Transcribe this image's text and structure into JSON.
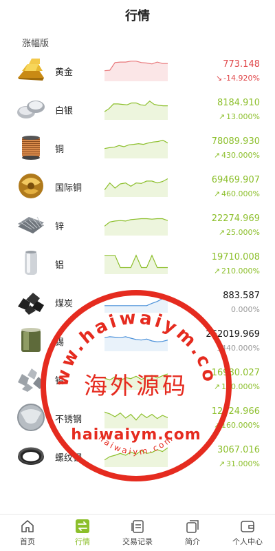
{
  "header": {
    "title": "行情"
  },
  "section": {
    "title": "涨幅版"
  },
  "colors": {
    "up": "#8cbf2b",
    "down": "#e0474a",
    "flat": "#111111",
    "accent": "#8cbf2b"
  },
  "items": [
    {
      "name": "黄金",
      "price": "773.148",
      "change": "-14.920%",
      "trend": "down",
      "icon": "gold-bars-icon",
      "spark": [
        0.45,
        0.47,
        0.8,
        0.82,
        0.82,
        0.86,
        0.86,
        0.8,
        0.78,
        0.74,
        0.82,
        0.76,
        0.76
      ]
    },
    {
      "name": "白银",
      "price": "8184.910",
      "change": "13.000%",
      "trend": "up",
      "icon": "silver-ingots-icon",
      "spark": [
        0.35,
        0.48,
        0.68,
        0.68,
        0.66,
        0.64,
        0.72,
        0.72,
        0.64,
        0.62,
        0.8,
        0.66,
        0.62,
        0.6,
        0.6
      ]
    },
    {
      "name": "铜",
      "price": "78089.930",
      "change": "430.000%",
      "trend": "up",
      "icon": "copper-coil-icon",
      "spark": [
        0.42,
        0.46,
        0.48,
        0.55,
        0.5,
        0.58,
        0.6,
        0.63,
        0.6,
        0.66,
        0.7,
        0.72,
        0.78,
        0.66
      ]
    },
    {
      "name": "国际铜",
      "price": "69469.907",
      "change": "460.000%",
      "trend": "up",
      "icon": "copper-ball-icon",
      "spark": [
        0.3,
        0.6,
        0.38,
        0.56,
        0.6,
        0.46,
        0.6,
        0.58,
        0.68,
        0.68,
        0.6,
        0.66,
        0.78
      ]
    },
    {
      "name": "锌",
      "price": "22274.969",
      "change": "25.000%",
      "trend": "up",
      "icon": "zinc-sheets-icon",
      "spark": [
        0.4,
        0.58,
        0.62,
        0.64,
        0.62,
        0.68,
        0.7,
        0.72,
        0.72,
        0.7,
        0.72,
        0.72,
        0.64
      ]
    },
    {
      "name": "铝",
      "price": "19710.008",
      "change": "210.000%",
      "trend": "up",
      "icon": "aluminum-can-icon",
      "spark": [
        0.8,
        0.8,
        0.8,
        0.28,
        0.28,
        0.28,
        0.8,
        0.28,
        0.28,
        0.8,
        0.28,
        0.28,
        0.28
      ]
    },
    {
      "name": "煤炭",
      "price": "883.587",
      "change": "0.000%",
      "trend": "flat",
      "icon": "coal-icon",
      "spark": [
        0.3,
        0.3,
        0.3,
        0.3,
        0.3,
        0.3,
        0.3,
        0.3,
        0.3,
        0.4,
        0.48,
        0.6,
        0.68
      ]
    },
    {
      "name": "锡",
      "price": "262019.969",
      "change": "1440.000%",
      "trend": "flat",
      "icon": "tin-can-icon",
      "spark": [
        0.58,
        0.62,
        0.6,
        0.58,
        0.62,
        0.56,
        0.5,
        0.48,
        0.52,
        0.44,
        0.4,
        0.42,
        0.48
      ]
    },
    {
      "name": "铅",
      "price": "16980.027",
      "change": "190.000%",
      "trend": "up",
      "icon": "lead-chunks-icon",
      "spark": [
        0.5,
        0.42,
        0.56,
        0.38,
        0.52,
        0.48,
        0.58,
        0.44,
        0.56,
        0.62,
        0.5,
        0.6,
        0.68
      ]
    },
    {
      "name": "不锈钢",
      "price": "12424.966",
      "change": "160.000%",
      "trend": "up",
      "icon": "steel-disc-icon",
      "spark": [
        0.7,
        0.62,
        0.5,
        0.66,
        0.44,
        0.6,
        0.36,
        0.62,
        0.46,
        0.6,
        0.42,
        0.56,
        0.46
      ]
    },
    {
      "name": "螺纹钢",
      "price": "3067.016",
      "change": "31.000%",
      "trend": "up",
      "icon": "rebar-coil-icon",
      "spark": [
        0.3,
        0.44,
        0.5,
        0.58,
        0.5,
        0.64,
        0.54,
        0.7,
        0.58,
        0.62,
        0.74,
        0.66,
        0.82
      ]
    }
  ],
  "watermark": {
    "arc_text": "www.haiwaiym.com",
    "center_text": "海外源码",
    "band_text": "haiwaiym.com",
    "bottom_text": "haiwaiym.com"
  },
  "tabbar": [
    {
      "label": "首页",
      "icon": "home-icon",
      "active": false
    },
    {
      "label": "行情",
      "icon": "exchange-icon",
      "active": true
    },
    {
      "label": "交易记录",
      "icon": "records-icon",
      "active": false
    },
    {
      "label": "简介",
      "icon": "intro-icon",
      "active": false
    },
    {
      "label": "个人中心",
      "icon": "wallet-icon",
      "active": false
    }
  ]
}
